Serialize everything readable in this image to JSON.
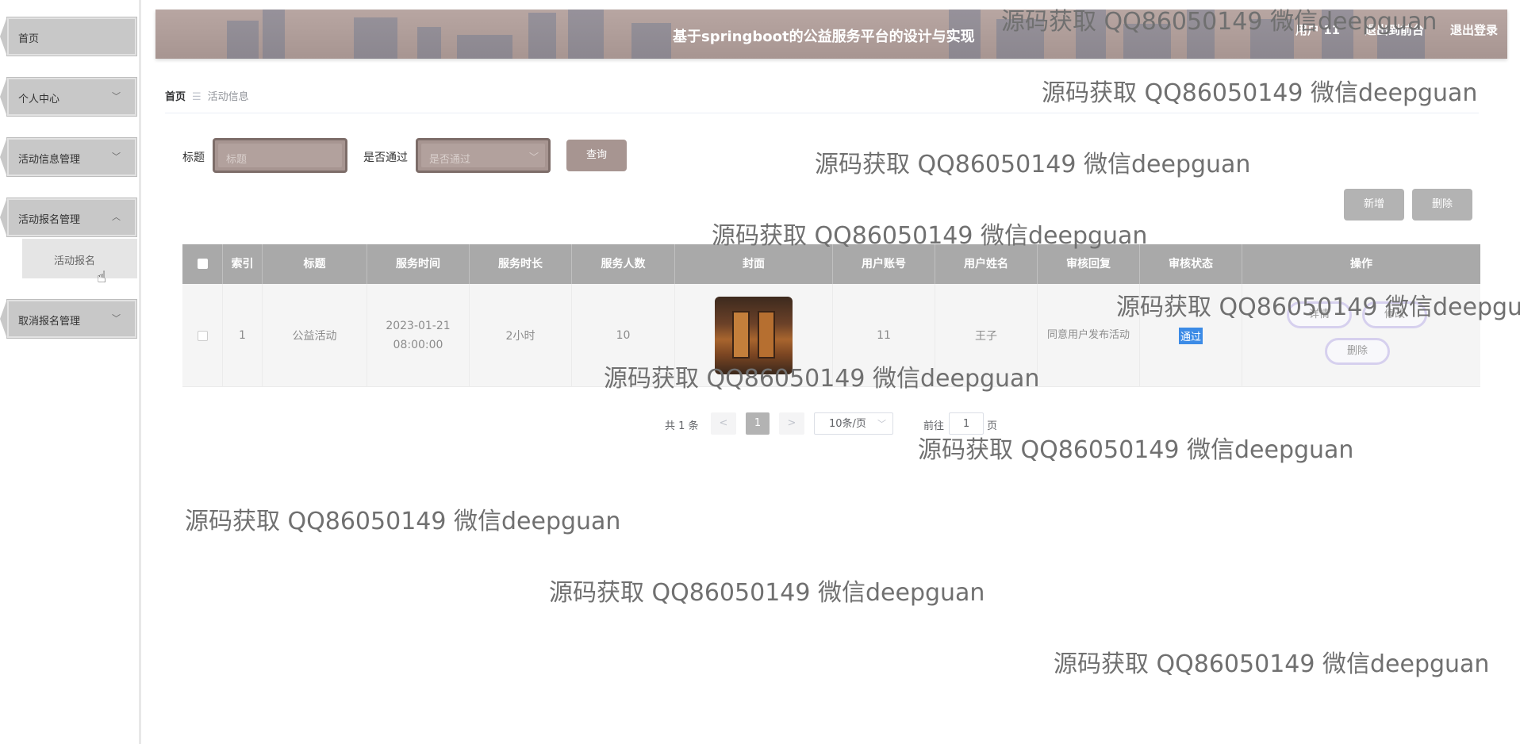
{
  "sidebar": {
    "items": [
      {
        "label": "首页"
      },
      {
        "label": "个人中心",
        "chevron": "chevron-down-icon"
      },
      {
        "label": "活动信息管理",
        "chevron": "chevron-down-icon"
      },
      {
        "label": "活动报名管理",
        "chevron": "chevron-up-icon"
      },
      {
        "label": "取消报名管理",
        "chevron": "chevron-down-icon"
      }
    ],
    "submenu": {
      "label": "活动报名"
    }
  },
  "header": {
    "title": "基于springboot的公益服务平台的设计与实现",
    "user": "用户 11",
    "exit_front": "退出到前台",
    "logout": "退出登录"
  },
  "breadcrumb": {
    "home": "首页",
    "current": "活动信息"
  },
  "search": {
    "title_label": "标题",
    "title_placeholder": "标题",
    "pass_label": "是否通过",
    "pass_placeholder": "是否通过",
    "query_button": "查询"
  },
  "actions": {
    "add": "新增",
    "delete": "删除"
  },
  "table": {
    "columns": [
      "索引",
      "标题",
      "服务时间",
      "服务时长",
      "服务人数",
      "封面",
      "用户账号",
      "用户姓名",
      "审核回复",
      "审核状态",
      "操作"
    ],
    "rows": [
      {
        "index": "1",
        "title": "公益活动",
        "service_time": "2023-01-21 08:00:00",
        "duration": "2小时",
        "people": "10",
        "account": "11",
        "name": "王子",
        "review_reply": "同意用户发布活动",
        "status": "通过",
        "op_detail": "详情",
        "op_edit": "修改",
        "op_delete": "删除"
      }
    ]
  },
  "pagination": {
    "total": "共 1 条",
    "prev": "<",
    "current": "1",
    "next": ">",
    "page_size": "10条/页",
    "goto_label": "前往",
    "goto_value": "1",
    "page_unit": "页"
  },
  "watermark": "源码获取 QQ86050149 微信deepguan",
  "colors": {
    "header": "#a79591",
    "button": "#a79591",
    "table_header": "#a9a9a9",
    "status_badge": "#3c8be6"
  }
}
